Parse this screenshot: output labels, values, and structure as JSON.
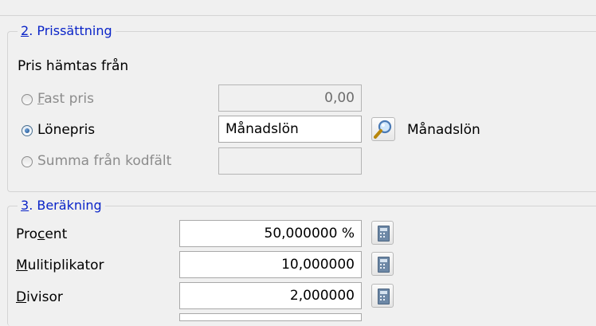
{
  "section2": {
    "number": "2",
    "title": ". Prissättning",
    "source_label": "Pris hämtas från",
    "options": [
      {
        "mnemonic": "F",
        "rest": "ast pris",
        "value": "0,00",
        "selected": false,
        "enabled": false
      },
      {
        "label": "Lönepris",
        "value": "Månadslön",
        "selected": true,
        "enabled": true,
        "resolved_name": "Månadslön"
      },
      {
        "label": "Summa från kodfält",
        "value": "",
        "selected": false,
        "enabled": false
      }
    ]
  },
  "section3": {
    "number": "3",
    "title": ". Beräkning",
    "rows": [
      {
        "pre": "Pro",
        "mnemonic": "c",
        "post": "ent",
        "value": "50,000000 %"
      },
      {
        "pre": "",
        "mnemonic": "M",
        "post": "ulitiplikator",
        "value": "10,000000"
      },
      {
        "pre": "",
        "mnemonic": "D",
        "post": "ivisor",
        "value": "2,000000"
      }
    ]
  },
  "icons": {
    "lookup": "magnifier-icon",
    "calculator": "calculator-icon"
  },
  "colors": {
    "group_title": "#0a24c8",
    "disabled_text": "#8c8c8c",
    "window_bg": "#f0f0f0"
  }
}
